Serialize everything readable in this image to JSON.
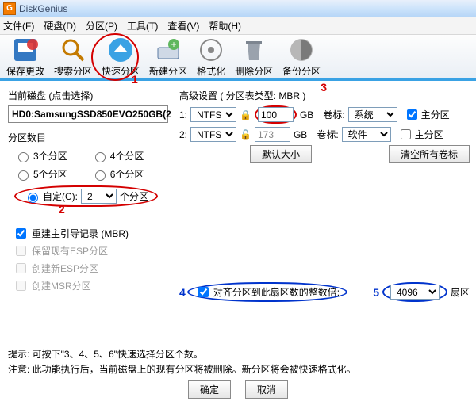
{
  "title": "DiskGenius",
  "menu": [
    "文件(F)",
    "硬盘(D)",
    "分区(P)",
    "工具(T)",
    "查看(V)",
    "帮助(H)"
  ],
  "toolbar": [
    {
      "label": "保存更改"
    },
    {
      "label": "搜索分区"
    },
    {
      "label": "快速分区"
    },
    {
      "label": "新建分区"
    },
    {
      "label": "格式化"
    },
    {
      "label": "删除分区"
    },
    {
      "label": "备份分区"
    }
  ],
  "left": {
    "currentDiskLabel": "当前磁盘 (点击选择)",
    "currentDisk": "HD0:SamsungSSD850EVO250GB(2",
    "countLabel": "分区数目",
    "r3": "3个分区",
    "r4": "4个分区",
    "r5": "5个分区",
    "r6": "6个分区",
    "customLabel": "自定(C):",
    "customVal": "2",
    "customUnit": "个分区",
    "chk1": "重建主引导记录 (MBR)",
    "chk2": "保留现有ESP分区",
    "chk3": "创建新ESP分区",
    "chk4": "创建MSR分区"
  },
  "right": {
    "advLabel": "高级设置  ( 分区表类型: MBR )",
    "rows": [
      {
        "n": "1:",
        "fs": "NTFS",
        "size": "100",
        "gb": "GB",
        "volLbl": "卷标:",
        "vol": "系统",
        "prim": "主分区",
        "primChecked": true
      },
      {
        "n": "2:",
        "fs": "NTFS",
        "size": "173",
        "gb": "GB",
        "volLbl": "卷标:",
        "vol": "软件",
        "prim": "主分区",
        "primChecked": false
      }
    ],
    "defaultBtn": "默认大小",
    "clearBtn": "清空所有卷标",
    "alignChk": "对齐分区到此扇区数的整数倍:",
    "alignVal": "4096",
    "alignUnit": "扇区"
  },
  "marks": {
    "m1": "1",
    "m2": "2",
    "m3": "3",
    "m4": "4",
    "m5": "5"
  },
  "hints": {
    "h1": "提示:  可按下\"3、4、5、6\"快速选择分区个数。",
    "h2": "注意:  此功能执行后，当前磁盘上的现有分区将被删除。新分区将会被快速格式化。"
  },
  "footer": {
    "ok": "确定",
    "cancel": "取消"
  }
}
